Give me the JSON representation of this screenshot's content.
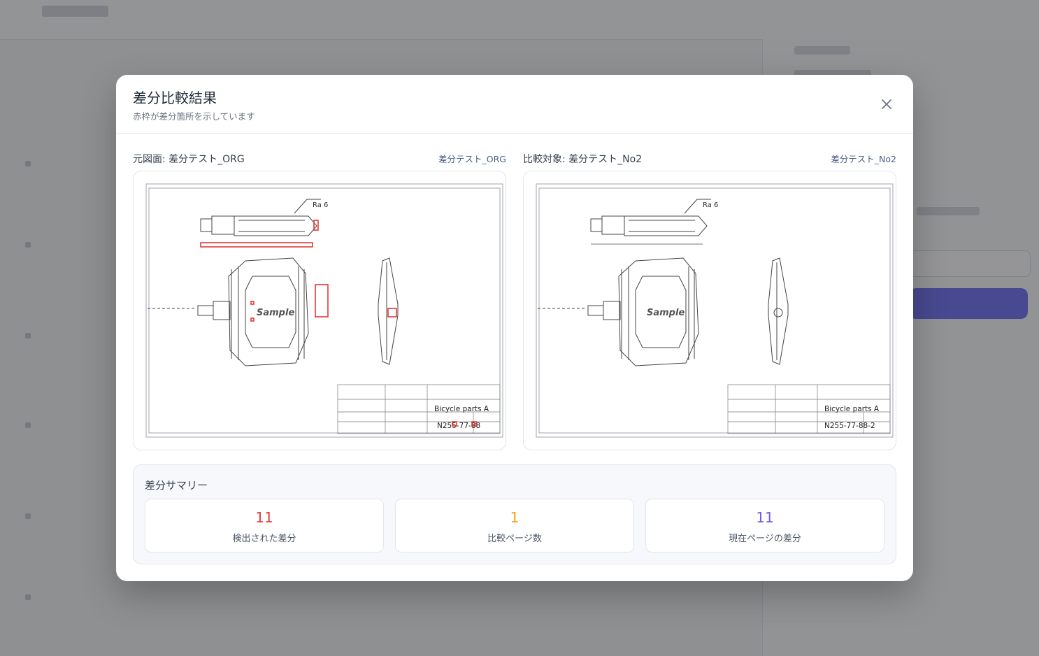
{
  "modal": {
    "title": "差分比較結果",
    "subtitle": "赤枠が差分箇所を示しています"
  },
  "left_panel": {
    "label": "元図面: 差分テスト_ORG",
    "file": "差分テスト_ORG",
    "drawing_part_name": "Bicycle parts A",
    "drawing_number": "N255-77-88",
    "drawing_logo": "Sample",
    "roughness": "Ra 6"
  },
  "right_panel": {
    "label": "比較対象: 差分テスト_No2",
    "file": "差分テスト_No2",
    "drawing_part_name": "Bicycle parts A",
    "drawing_number": "N255-77-88-2",
    "drawing_logo": "Sample",
    "roughness": "Ra 6"
  },
  "summary": {
    "title": "差分サマリー",
    "stats": [
      {
        "value": "11",
        "label": "検出された差分",
        "color": "#e5393b"
      },
      {
        "value": "1",
        "label": "比較ページ数",
        "color": "#f59e0b"
      },
      {
        "value": "11",
        "label": "現在ページの差分",
        "color": "#6d5ce8"
      }
    ]
  },
  "colors": {
    "diff_highlight": "#e53935",
    "accent": "#5b5cf0"
  },
  "icons": {
    "close": "close-icon"
  }
}
